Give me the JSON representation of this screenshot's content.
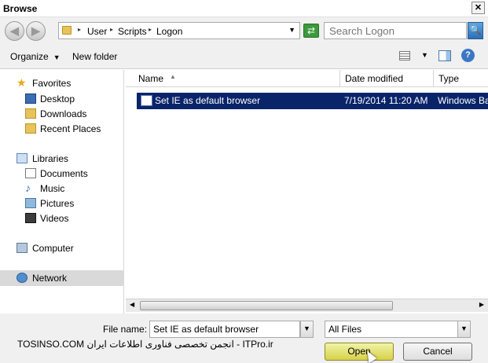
{
  "window": {
    "title": "Browse",
    "close_glyph": "✕"
  },
  "nav": {
    "back_glyph": "◀",
    "forward_glyph": "▶",
    "breadcrumbs": [
      "User",
      "Scripts",
      "Logon"
    ],
    "search_placeholder": "Search Logon",
    "refresh_glyph": "⇄",
    "search_glyph": "🔍"
  },
  "toolbar": {
    "organize": "Organize",
    "new_folder": "New folder",
    "help_glyph": "?"
  },
  "sidebar": {
    "items": [
      {
        "label": "Favorites",
        "icon": "star-icon"
      },
      {
        "label": "Desktop",
        "icon": "desktop-icon"
      },
      {
        "label": "Downloads",
        "icon": "downloads-icon"
      },
      {
        "label": "Recent Places",
        "icon": "recent-places-icon"
      },
      {
        "label": "Libraries",
        "icon": "libraries-icon"
      },
      {
        "label": "Documents",
        "icon": "documents-icon"
      },
      {
        "label": "Music",
        "icon": "music-icon"
      },
      {
        "label": "Pictures",
        "icon": "pictures-icon"
      },
      {
        "label": "Videos",
        "icon": "videos-icon"
      },
      {
        "label": "Computer",
        "icon": "computer-icon"
      },
      {
        "label": "Network",
        "icon": "network-icon"
      }
    ]
  },
  "columns": {
    "name": "Name",
    "date_modified": "Date modified",
    "type": "Type"
  },
  "files": [
    {
      "name": "Set IE as default browser",
      "date_modified": "7/19/2014 11:20 AM",
      "type": "Windows Batch File"
    }
  ],
  "footer": {
    "file_name_label": "File name:",
    "file_name_value": "Set IE as default browser",
    "file_type_value": "All Files",
    "open_label": "Open",
    "cancel_label": "Cancel",
    "watermark": "TOSINSO.COM انجمن تخصصی فناوری اطلاعات ایران - ITPro.ir"
  },
  "colors": {
    "selection": "#0a246a",
    "open_button_highlight": "#d7d04a"
  }
}
